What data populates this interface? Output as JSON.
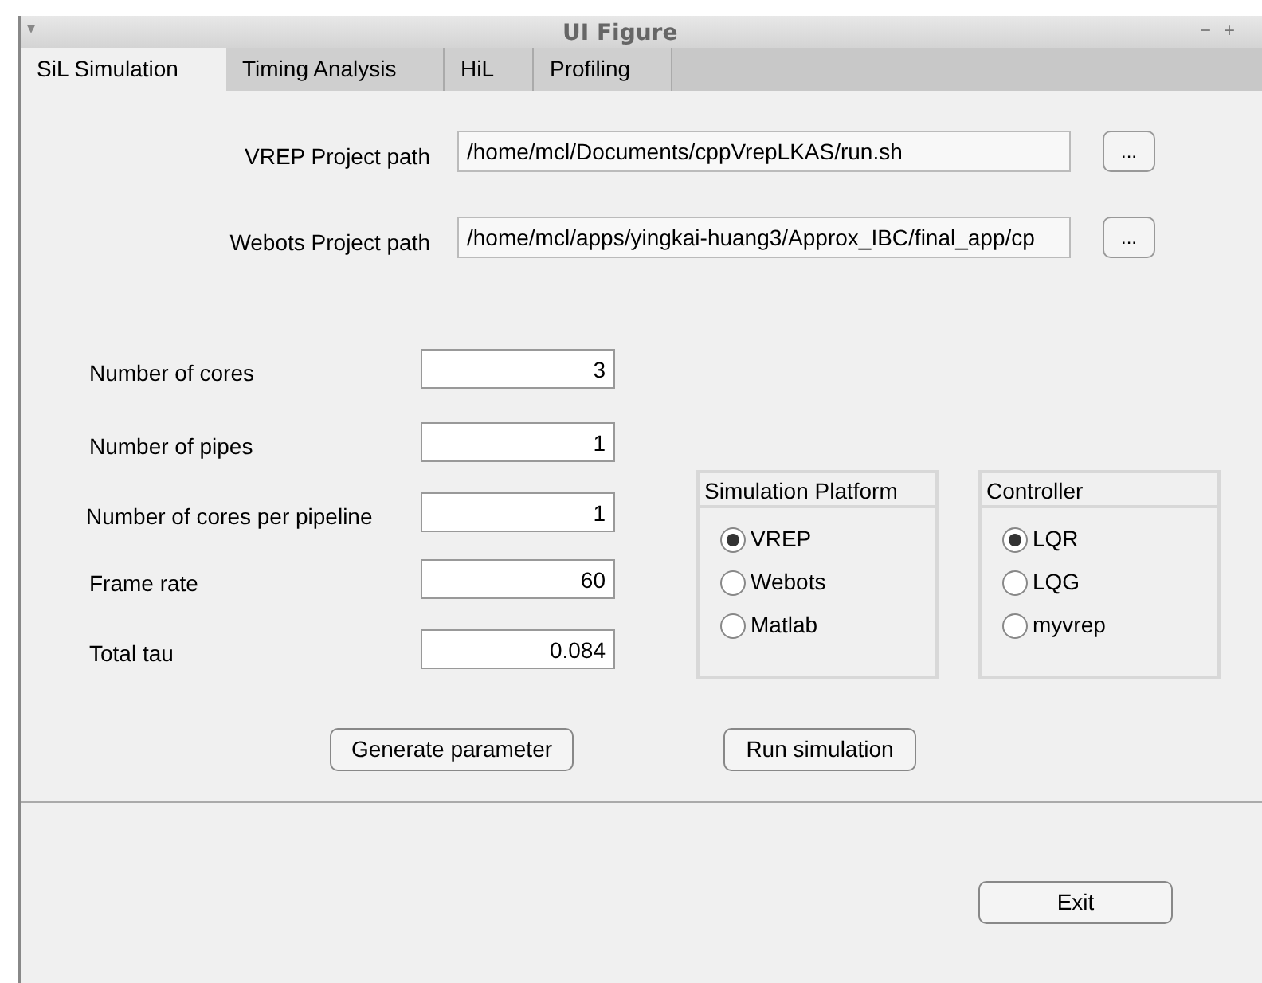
{
  "window": {
    "title": "UI Figure",
    "menu_glyph": "▾",
    "controls": [
      "−",
      "+"
    ]
  },
  "tabs": [
    {
      "label": "SiL Simulation",
      "selected": true
    },
    {
      "label": "Timing Analysis",
      "selected": false
    },
    {
      "label": "HiL",
      "selected": false
    },
    {
      "label": "Profiling",
      "selected": false
    }
  ],
  "paths": [
    {
      "label": "VREP Project path",
      "value": "/home/mcl/Documents/cppVrepLKAS/run.sh",
      "browse": "..."
    },
    {
      "label": "Webots Project path",
      "value": "/home/mcl/apps/yingkai-huang3/Approx_IBC/final_app/cp",
      "browse": "..."
    }
  ],
  "parameters": [
    {
      "label": "Number of cores",
      "value": "3"
    },
    {
      "label": "Number of pipes",
      "value": "1"
    },
    {
      "label": "Number of cores per pipeline",
      "value": "1"
    },
    {
      "label": "Frame rate",
      "value": "60"
    },
    {
      "label": "Total tau",
      "value": "0.084"
    }
  ],
  "groups": [
    {
      "title": "Simulation Platform",
      "options": [
        {
          "label": "VREP",
          "selected": true
        },
        {
          "label": "Webots",
          "selected": false
        },
        {
          "label": "Matlab",
          "selected": false
        }
      ]
    },
    {
      "title": "Controller",
      "options": [
        {
          "label": "LQR",
          "selected": true
        },
        {
          "label": "LQG",
          "selected": false
        },
        {
          "label": "myvrep",
          "selected": false
        }
      ]
    }
  ],
  "actions": [
    "Generate parameter",
    "Run simulation"
  ],
  "exit_button": "Exit"
}
